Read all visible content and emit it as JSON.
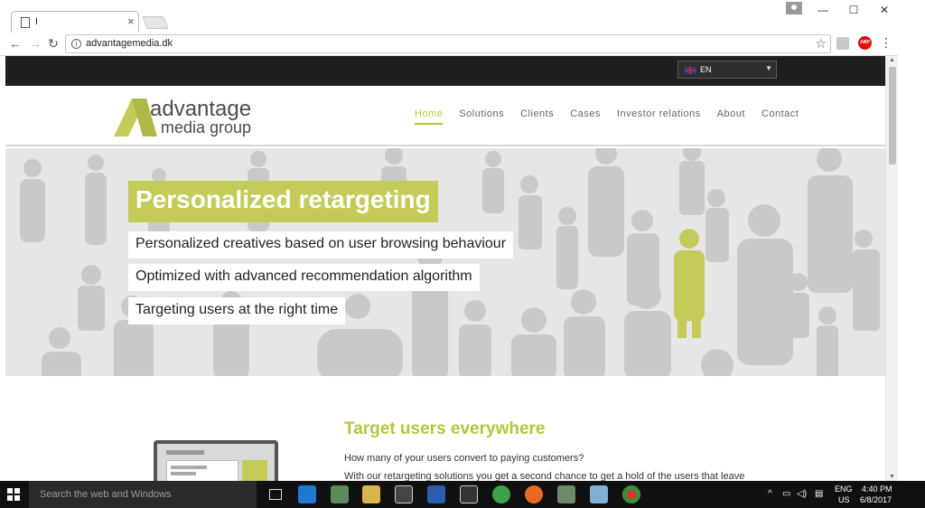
{
  "browser": {
    "tab_title": "I",
    "url": "advantagemedia.dk",
    "tab_close": "×",
    "controls": {
      "minimize": "—",
      "maximize": "☐",
      "close": "✕"
    }
  },
  "site": {
    "language": {
      "selected": "EN"
    },
    "logo": {
      "line1": "advantage",
      "line2": "media group"
    },
    "nav": [
      {
        "label": "Home",
        "active": true
      },
      {
        "label": "Solutions"
      },
      {
        "label": "Clients"
      },
      {
        "label": "Cases"
      },
      {
        "label": "Investor relations"
      },
      {
        "label": "About"
      },
      {
        "label": "Contact"
      }
    ],
    "hero": {
      "title": "Personalized retargeting",
      "lines": [
        "Personalized creatives based on user browsing behaviour",
        "Optimized with advanced recommendation algorithm",
        "Targeting users at the right time"
      ]
    },
    "section": {
      "title": "Target users everywhere",
      "p1": "How many of your users convert to paying customers?",
      "p2": "With our retargeting solutions you get a second chance to get a hold of the users that leave"
    }
  },
  "taskbar": {
    "search_placeholder": "Search the web and Windows",
    "lang_top": "ENG",
    "lang_bottom": "US",
    "time": "4:40 PM",
    "date": "6/8/2017"
  },
  "colors": {
    "accent": "#c4cb59",
    "accent_text": "#b9c43d",
    "topbar": "#1f1f1f"
  }
}
